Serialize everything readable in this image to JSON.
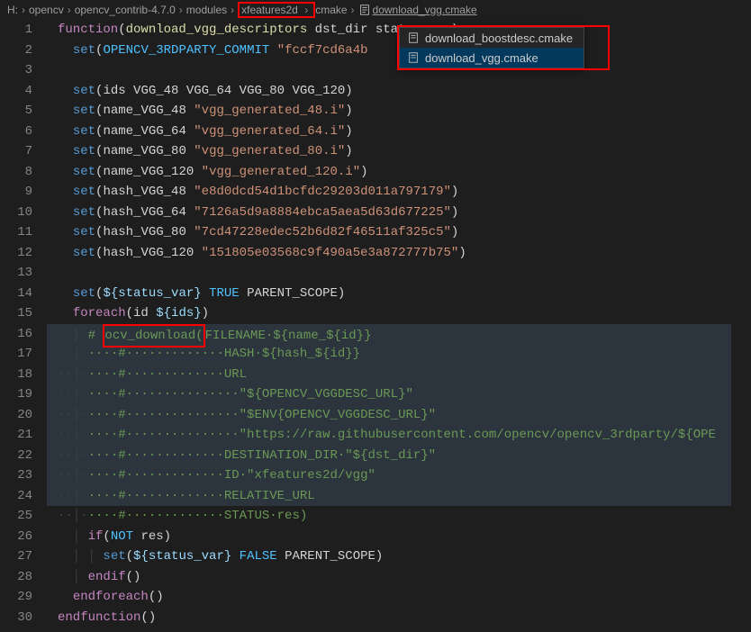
{
  "breadcrumbs": {
    "parts": [
      "H:",
      "opencv",
      "opencv_contrib-4.7.0",
      "modules",
      "xfeatures2d",
      "cmake"
    ],
    "file": "download_vgg.cmake"
  },
  "dropdown": {
    "items": [
      "download_boostdesc.cmake",
      "download_vgg.cmake"
    ]
  },
  "line_numbers": [
    "1",
    "2",
    "3",
    "4",
    "5",
    "6",
    "7",
    "8",
    "9",
    "10",
    "11",
    "12",
    "13",
    "14",
    "15",
    "16",
    "17",
    "18",
    "19",
    "20",
    "21",
    "22",
    "23",
    "24",
    "25",
    "26",
    "27",
    "28",
    "29",
    "30"
  ],
  "code": {
    "l1_fn": "function",
    "l1_name": "download_vgg_descriptors",
    "l1_args": " dst_dir status_var)",
    "set": "set",
    "l2_var": "OPENCV_3RDPARTY_COMMIT",
    "l2_str": "\"fccf7cd6a4b",
    "l4_ids": "ids VGG_48 VGG_64 VGG_80 VGG_120",
    "l5_name": "name_VGG_48",
    "l5_str": "\"vgg_generated_48.i\"",
    "l6_name": "name_VGG_64",
    "l6_str": "\"vgg_generated_64.i\"",
    "l7_name": "name_VGG_80",
    "l7_str": "\"vgg_generated_80.i\"",
    "l8_name": "name_VGG_120",
    "l8_str": "\"vgg_generated_120.i\"",
    "l9_name": "hash_VGG_48",
    "l9_str": "\"e8d0dcd54d1bcfdc29203d011a797179\"",
    "l10_name": "hash_VGG_64",
    "l10_str": "\"7126a5d9a8884ebca5aea5d63d677225\"",
    "l11_name": "hash_VGG_80",
    "l11_str": "\"7cd47228edec52b6d82f46511af325c5\"",
    "l12_name": "hash_VGG_120",
    "l12_str": "\"151805e03568c9f490a5e3a872777b75\"",
    "l14_status": "${status_var}",
    "l14_true": "TRUE",
    "l14_parent": "PARENT_SCOPE",
    "foreach": "foreach",
    "l15_id": "id",
    "l15_ids": "${ids}",
    "l16_cmt": "# ",
    "l16_ocv": "ocv_download(",
    "l16_rest": "FILENAME·${name_${id}}",
    "l17": "····#·············HASH·${hash_${id}}",
    "l18": "····#·············URL",
    "l19": "····#···············\"${OPENCV_VGGDESC_URL}\"",
    "l20": "····#···············\"$ENV{OPENCV_VGGDESC_URL}\"",
    "l21": "····#···············\"https://raw.githubusercontent.com/opencv/opencv_3rdparty/${OPE",
    "l22": "····#·············DESTINATION_DIR·\"${dst_dir}\"",
    "l23": "····#·············ID·\"xfeatures2d/vgg\"",
    "l24": "····#·············RELATIVE_URL",
    "l25": "····#·············STATUS·res)",
    "if": "if",
    "not": "NOT",
    "res": "res",
    "l27_false": "FALSE",
    "endif": "endif",
    "endforeach": "endforeach",
    "endfunction": "endfunction"
  }
}
